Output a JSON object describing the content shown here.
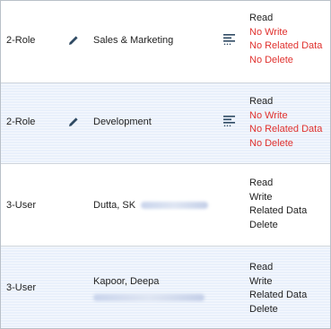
{
  "rows": [
    {
      "type": "2-Role",
      "name": "Sales & Marketing",
      "perms": [
        {
          "label": "Read",
          "on": true
        },
        {
          "label": "No Write",
          "on": false
        },
        {
          "label": "No Related Data",
          "on": false
        },
        {
          "label": "No Delete",
          "on": false
        }
      ]
    },
    {
      "type": "2-Role",
      "name": "Development",
      "perms": [
        {
          "label": "Read",
          "on": true
        },
        {
          "label": "No Write",
          "on": false
        },
        {
          "label": "No Related Data",
          "on": false
        },
        {
          "label": "No Delete",
          "on": false
        }
      ]
    },
    {
      "type": "3-User",
      "name": "Dutta, SK",
      "perms": [
        {
          "label": "Read",
          "on": true
        },
        {
          "label": "Write",
          "on": true
        },
        {
          "label": "Related Data",
          "on": true
        },
        {
          "label": "Delete",
          "on": true
        }
      ]
    },
    {
      "type": "3-User",
      "name": "Kapoor, Deepa",
      "perms": [
        {
          "label": "Read",
          "on": true
        },
        {
          "label": "Write",
          "on": true
        },
        {
          "label": "Related Data",
          "on": true
        },
        {
          "label": "Delete",
          "on": true
        }
      ]
    }
  ],
  "colors": {
    "permission_granted": "#222222",
    "permission_denied": "#e0322f",
    "shaded_row": "#e9f0fb",
    "icon": "#2f4a63"
  },
  "icons": {
    "edit": "pencil-icon",
    "detail": "list-lines-icon"
  }
}
